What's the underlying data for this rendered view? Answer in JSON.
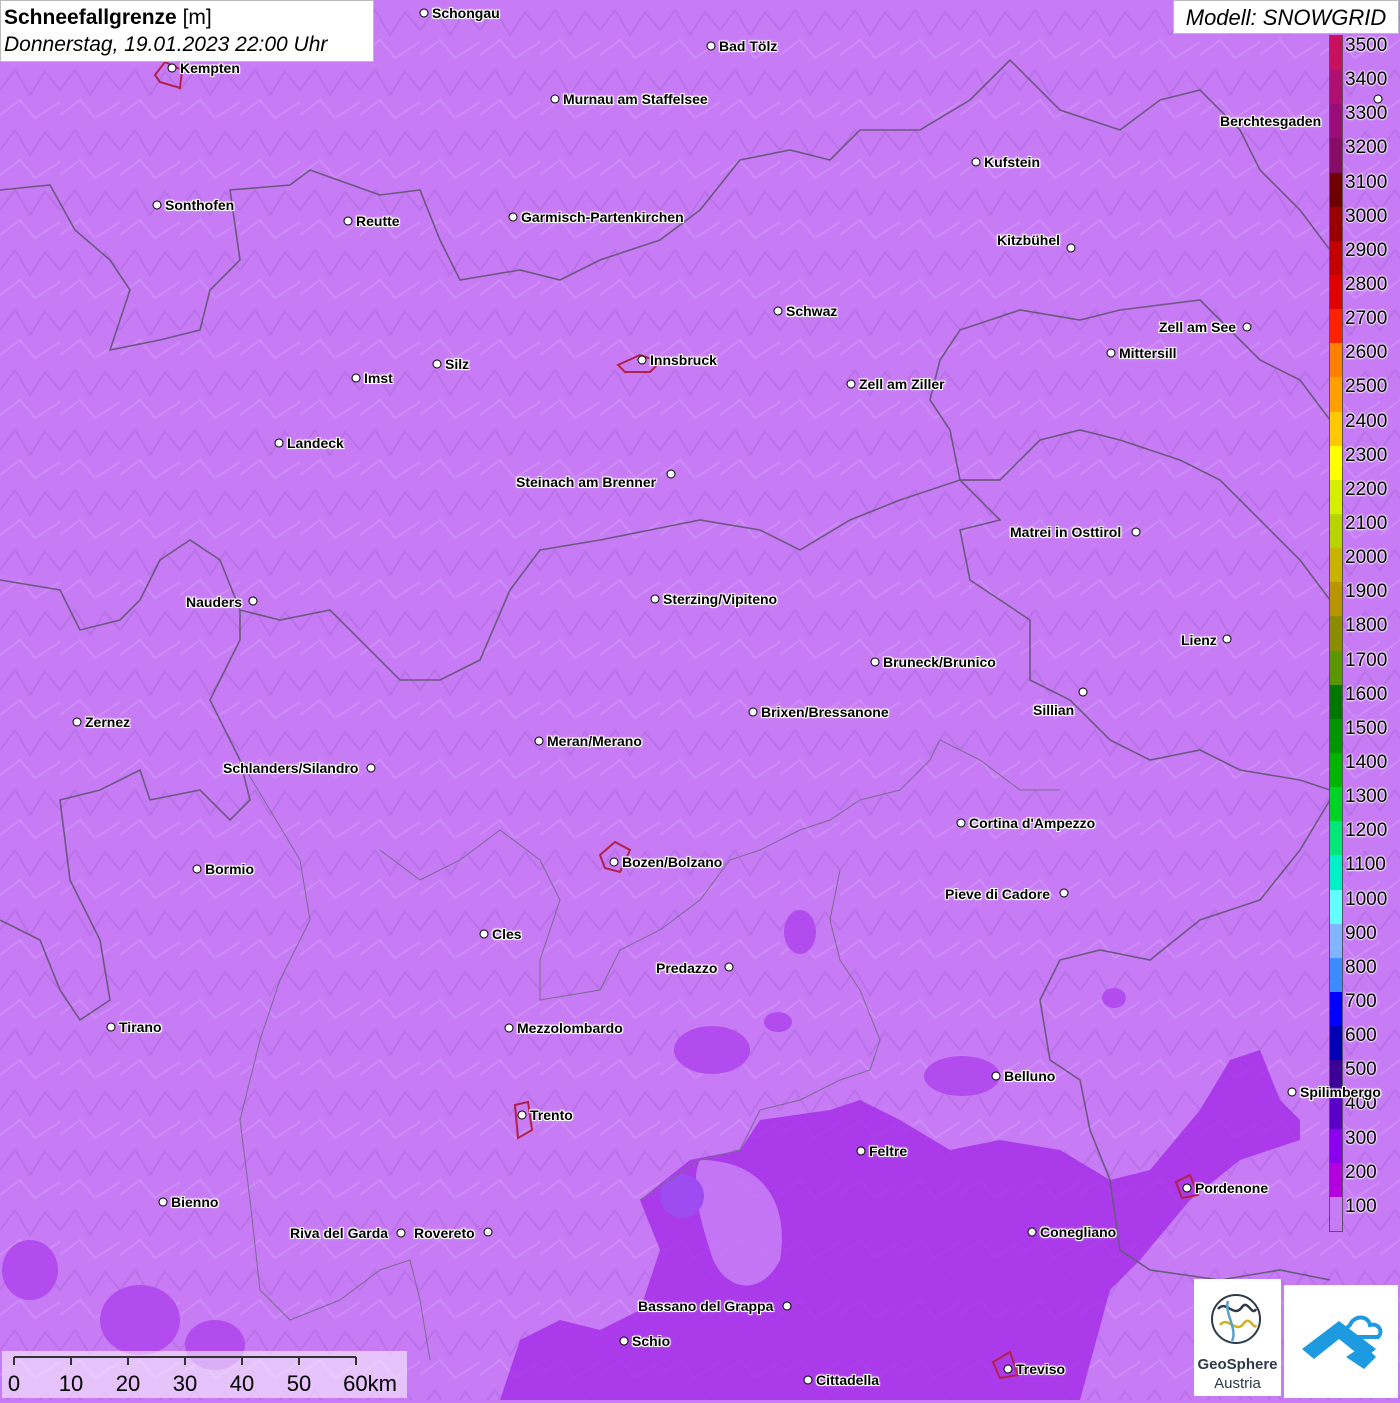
{
  "header": {
    "title_bold": "Schneefallgrenze",
    "title_unit": "[m]",
    "datetime": "Donnerstag, 19.01.2023 22:00 Uhr"
  },
  "model_label": "Modell: SNOWGRID",
  "legend": {
    "labels": [
      "3500",
      "3400",
      "3300",
      "3200",
      "3100",
      "3000",
      "2900",
      "2800",
      "2700",
      "2600",
      "2500",
      "2400",
      "2300",
      "2200",
      "2100",
      "2000",
      "1900",
      "1800",
      "1700",
      "1600",
      "1500",
      "1400",
      "1300",
      "1200",
      "1100",
      "1000",
      "900",
      "800",
      "700",
      "600",
      "500",
      "400",
      "300",
      "200",
      "100"
    ],
    "colors": [
      "#c8105e",
      "#b00e70",
      "#9a0c78",
      "#860c66",
      "#6e0000",
      "#9a0000",
      "#c40000",
      "#e00000",
      "#ff2200",
      "#ff8000",
      "#ffa000",
      "#ffc800",
      "#ffff00",
      "#d4f000",
      "#b8d400",
      "#c8b400",
      "#b89400",
      "#8c8c00",
      "#5a9600",
      "#007800",
      "#009600",
      "#00b400",
      "#00d228",
      "#00e678",
      "#00f0c8",
      "#64ffff",
      "#82b4ff",
      "#3c8cff",
      "#0000ff",
      "#0000b4",
      "#3c0096",
      "#5a00c8",
      "#8c00f0",
      "#b400dc",
      "#c77cf6"
    ]
  },
  "cities": [
    {
      "name": "Schongau",
      "label_side": "right"
    },
    {
      "name": "Bad Tölz",
      "label_side": "right"
    },
    {
      "name": "Kempten",
      "label_side": "right"
    },
    {
      "name": "Murnau am Staffelsee",
      "label_side": "right"
    },
    {
      "name": "Berchtesgaden",
      "label_side": "left"
    },
    {
      "name": "Kufstein",
      "label_side": "right"
    },
    {
      "name": "Sonthofen",
      "label_side": "right"
    },
    {
      "name": "Reutte",
      "label_side": "right"
    },
    {
      "name": "Garmisch-Partenkirchen",
      "label_side": "right"
    },
    {
      "name": "Kitzbühel",
      "label_side": "left"
    },
    {
      "name": "Schwaz",
      "label_side": "right"
    },
    {
      "name": "Zell am See",
      "label_side": "left"
    },
    {
      "name": "Innsbruck",
      "label_side": "right"
    },
    {
      "name": "Mittersill",
      "label_side": "right"
    },
    {
      "name": "Imst",
      "label_side": "right"
    },
    {
      "name": "Silz",
      "label_side": "right"
    },
    {
      "name": "Zell am Ziller",
      "label_side": "right"
    },
    {
      "name": "Landeck",
      "label_side": "right"
    },
    {
      "name": "Steinach am Brenner",
      "label_side": "left"
    },
    {
      "name": "Matrei in Osttirol",
      "label_side": "left"
    },
    {
      "name": "Nauders",
      "label_side": "left"
    },
    {
      "name": "Sterzing/Vipiteno",
      "label_side": "right"
    },
    {
      "name": "Lienz",
      "label_side": "left"
    },
    {
      "name": "Bruneck/Brunico",
      "label_side": "right"
    },
    {
      "name": "Sillian",
      "label_side": "left"
    },
    {
      "name": "Brixen/Bressanone",
      "label_side": "right"
    },
    {
      "name": "Zernez",
      "label_side": "right"
    },
    {
      "name": "Meran/Merano",
      "label_side": "right"
    },
    {
      "name": "Schlanders/Silandro",
      "label_side": "left"
    },
    {
      "name": "Cortina d'Ampezzo",
      "label_side": "right"
    },
    {
      "name": "Bozen/Bolzano",
      "label_side": "right"
    },
    {
      "name": "Bormio",
      "label_side": "right"
    },
    {
      "name": "Pieve di Cadore",
      "label_side": "left"
    },
    {
      "name": "Cles",
      "label_side": "right"
    },
    {
      "name": "Predazzo",
      "label_side": "left"
    },
    {
      "name": "Tirano",
      "label_side": "right"
    },
    {
      "name": "Mezzolombardo",
      "label_side": "right"
    },
    {
      "name": "Belluno",
      "label_side": "right"
    },
    {
      "name": "Spilimbergo",
      "label_side": "right"
    },
    {
      "name": "Trento",
      "label_side": "right"
    },
    {
      "name": "Feltre",
      "label_side": "right"
    },
    {
      "name": "Pordenone",
      "label_side": "right"
    },
    {
      "name": "Bienno",
      "label_side": "right"
    },
    {
      "name": "Riva del Garda",
      "label_side": "left"
    },
    {
      "name": "Rovereto",
      "label_side": "left"
    },
    {
      "name": "Conegliano",
      "label_side": "right"
    },
    {
      "name": "Bassano del Grappa",
      "label_side": "left"
    },
    {
      "name": "Schio",
      "label_side": "right"
    },
    {
      "name": "Treviso",
      "label_side": "right"
    },
    {
      "name": "Cittadella",
      "label_side": "right"
    }
  ],
  "scalebar": {
    "labels": [
      "0",
      "10",
      "20",
      "30",
      "40",
      "50",
      "60km"
    ]
  },
  "logos": {
    "geosphere_line1": "GeoSphere",
    "geosphere_line2": "Austria"
  }
}
